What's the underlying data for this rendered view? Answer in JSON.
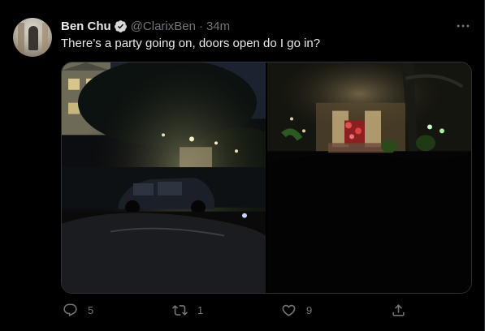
{
  "tweet": {
    "author_name": "Ben Chu",
    "author_handle": "@ClarixBen",
    "separator": "·",
    "time": "34m",
    "text": "There’s a party going on, doors open do I go in?",
    "more_icon": "more-horizontal-icon",
    "verified_icon": "verified-badge-icon",
    "media": [
      {
        "description_icon": "photo-night-street-cars"
      },
      {
        "description_icon": "photo-lit-house-porch"
      }
    ]
  },
  "actions": {
    "reply": {
      "icon": "reply-icon",
      "count": "5"
    },
    "retweet": {
      "icon": "retweet-icon",
      "count": "1"
    },
    "like": {
      "icon": "like-icon",
      "count": "9"
    },
    "share": {
      "icon": "share-icon",
      "count": ""
    }
  },
  "colors": {
    "background": "#000000",
    "text_primary": "#e7e9ea",
    "text_secondary": "#71767b",
    "verified": "#d9d9d9",
    "border": "#2f3336"
  }
}
